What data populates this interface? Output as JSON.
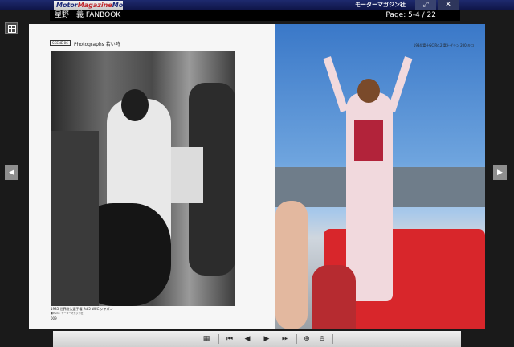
{
  "top_bar": {
    "brand_left_prefix": "Motor",
    "brand_left_accent": "Magazine",
    "brand_left_suffix": "Mook",
    "brand_right": "モーターマガジン社",
    "maximize_icon": "⤢",
    "close_icon": "✕"
  },
  "title_bar": {
    "title": "星野一義 FANBOOK",
    "page_indicator": "Page:  5-4 / 22"
  },
  "navigation": {
    "prev_icon": "◀",
    "next_icon": "▶"
  },
  "left_page": {
    "scene_label": "SCENE 06",
    "scene_title": "Photographs 若い時",
    "caption": "1985 世界耐久選手権 Rd.5 WEC ジャパン",
    "caption_sub": "■Photo: モーターマガジン社",
    "page_number": "009"
  },
  "right_page": {
    "caption": "1984 富士GC Rd.2 富士グラン 200 キロ"
  },
  "toolbar": {
    "grid_icon": "▦",
    "first_icon": "⏮",
    "prev_icon": "◀",
    "next_icon": "▶",
    "last_icon": "⏭",
    "zoom_in_icon": "⊕",
    "zoom_out_icon": "⊖"
  },
  "colors": {
    "top_bar": "#1e2a6e",
    "background": "#1a1a1a",
    "toolbar": "#dcdcdc"
  }
}
